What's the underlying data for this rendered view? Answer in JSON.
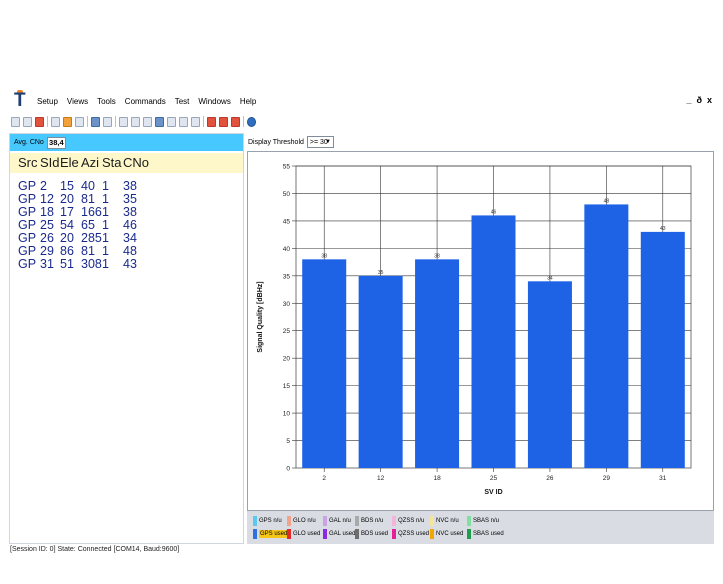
{
  "menubar": {
    "items": [
      "Setup",
      "Views",
      "Tools",
      "Commands",
      "Test",
      "Windows",
      "Help"
    ],
    "window_controls": [
      "_",
      "ð",
      "x"
    ]
  },
  "toolbar": {
    "icons": [
      "doc-icon",
      "print-icon",
      "delete-icon",
      "sep",
      "stop-icon",
      "pause-icon",
      "record-icon",
      "sep",
      "save-icon",
      "save-as-icon",
      "sep",
      "view-icon",
      "grid-icon",
      "bars-icon",
      "star-icon",
      "plus-icon",
      "table-icon",
      "chart-icon",
      "sep",
      "tool1-icon",
      "tool2-icon",
      "tool3-icon",
      "sep",
      "help-icon"
    ]
  },
  "left_panel": {
    "avg_label": "Avg. CNo",
    "avg_value": "38,4",
    "headers": [
      "Src",
      "SId",
      "Ele",
      "Azi",
      "Sta",
      "CNo"
    ],
    "rows": [
      [
        "GP",
        "2",
        "15",
        "40",
        "1",
        "38"
      ],
      [
        "GP",
        "12",
        "20",
        "81",
        "1",
        "35"
      ],
      [
        "GP",
        "18",
        "17",
        "166",
        "1",
        "38"
      ],
      [
        "GP",
        "25",
        "54",
        "65",
        "1",
        "46"
      ],
      [
        "GP",
        "26",
        "20",
        "285",
        "1",
        "34"
      ],
      [
        "GP",
        "29",
        "86",
        "81",
        "1",
        "48"
      ],
      [
        "GP",
        "31",
        "51",
        "308",
        "1",
        "43"
      ]
    ]
  },
  "right_panel": {
    "threshold_label": "Display Threshold",
    "threshold_value": ">= 30"
  },
  "chart_data": {
    "type": "bar",
    "categories": [
      "2",
      "12",
      "18",
      "25",
      "26",
      "29",
      "31"
    ],
    "values": [
      38,
      35,
      38,
      46,
      34,
      48,
      43
    ],
    "xlabel": "SV ID",
    "ylabel": "Signal Quality [dBHz]",
    "ylim": [
      0,
      55
    ],
    "yticks": [
      0,
      5,
      10,
      15,
      20,
      25,
      30,
      35,
      40,
      45,
      50,
      55
    ],
    "grid": true,
    "bar_color": "#1e63e6"
  },
  "legend": {
    "items": [
      {
        "label": "GPS n/u",
        "color": "#5bc8f2"
      },
      {
        "label": "GLO n/u",
        "color": "#f2a48a"
      },
      {
        "label": "GAL n/u",
        "color": "#c9a3e3"
      },
      {
        "label": "BDS n/u",
        "color": "#a9a9a9"
      },
      {
        "label": "QZSS n/u",
        "color": "#f5b3d9"
      },
      {
        "label": "NVC n/u",
        "color": "#f6e49a"
      },
      {
        "label": "SBAS n/u",
        "color": "#7fe0a0"
      },
      {
        "label": "GPS used",
        "color": "#2f6fe0"
      },
      {
        "label": "GLO used",
        "color": "#e02a2a"
      },
      {
        "label": "GAL used",
        "color": "#8a2be2"
      },
      {
        "label": "BDS used",
        "color": "#6e6e6e"
      },
      {
        "label": "QZSS used",
        "color": "#e2209a"
      },
      {
        "label": "NVC used",
        "color": "#f0a800"
      },
      {
        "label": "SBAS used",
        "color": "#1e9e4a"
      }
    ],
    "highlight_label": "GPS used",
    "highlight_color": "#f5c518"
  },
  "statusbar": {
    "text": "[Session ID: 0] State: Connected [COM14, Baud:9600]"
  }
}
